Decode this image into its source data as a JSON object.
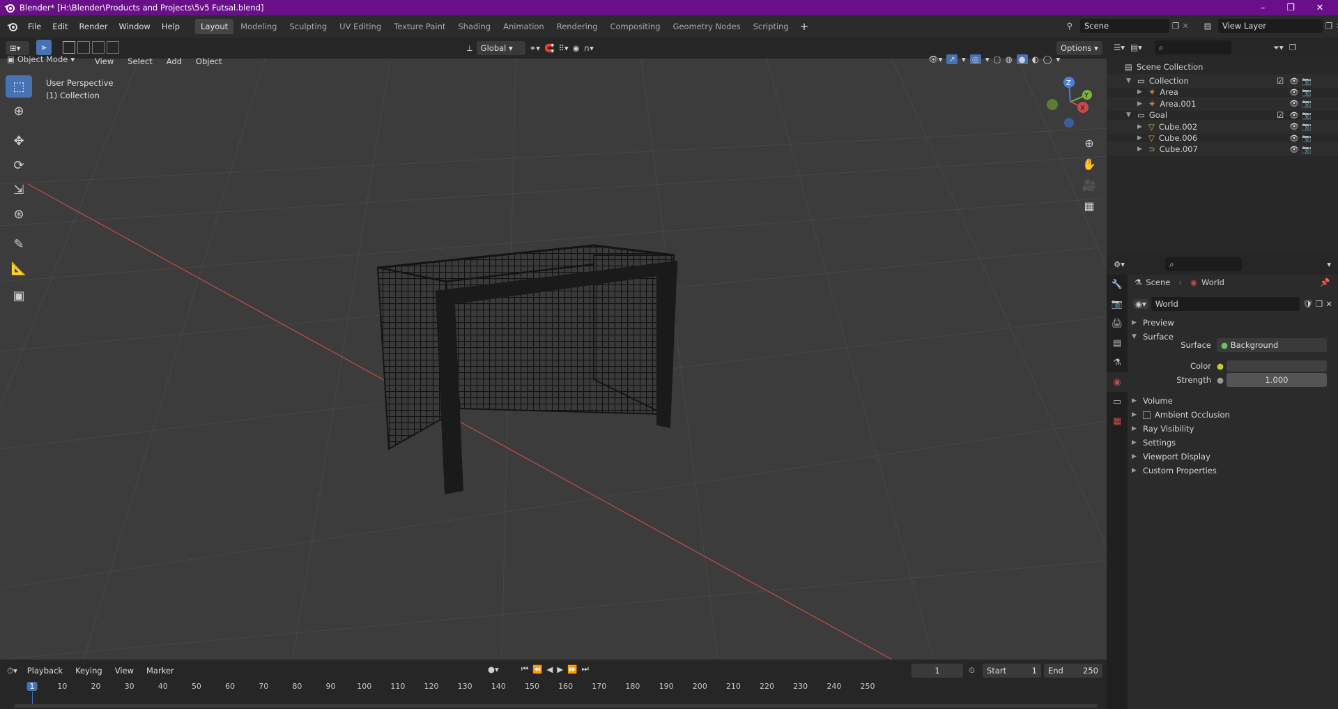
{
  "window": {
    "title": "Blender* [H:\\Blender\\Products and Projects\\5v5 Futsal.blend]",
    "minimize": "–",
    "maximize": "❐",
    "close": "✕"
  },
  "menu": [
    "File",
    "Edit",
    "Render",
    "Window",
    "Help"
  ],
  "workspaces": [
    {
      "label": "Layout",
      "active": true
    },
    {
      "label": "Modeling"
    },
    {
      "label": "Sculpting"
    },
    {
      "label": "UV Editing"
    },
    {
      "label": "Texture Paint"
    },
    {
      "label": "Shading"
    },
    {
      "label": "Animation"
    },
    {
      "label": "Rendering"
    },
    {
      "label": "Compositing"
    },
    {
      "label": "Geometry Nodes"
    },
    {
      "label": "Scripting"
    }
  ],
  "add_workspace": "+",
  "scene": {
    "name": "Scene"
  },
  "view_layer": {
    "name": "View Layer"
  },
  "viewport_header": {
    "transform_orientation": "Global",
    "options": "Options",
    "mode": "Object Mode",
    "menus": [
      "View",
      "Select",
      "Add",
      "Object"
    ]
  },
  "viewport": {
    "perspective": "User Perspective",
    "collection": "(1) Collection",
    "gizmo_axes": {
      "x": "X",
      "y": "Y",
      "z": "Z"
    }
  },
  "outliner": {
    "search_placeholder": "",
    "root": "Scene Collection",
    "items": [
      {
        "name": "Collection",
        "level": 0,
        "icon": "collection-icon",
        "expanded": true
      },
      {
        "name": "Area",
        "level": 1,
        "icon": "light-icon"
      },
      {
        "name": "Area.001",
        "level": 1,
        "icon": "light-icon"
      },
      {
        "name": "Goal",
        "level": 0,
        "icon": "collection-icon",
        "expanded": true
      },
      {
        "name": "Cube.002",
        "level": 1,
        "icon": "mesh-icon"
      },
      {
        "name": "Cube.006",
        "level": 1,
        "icon": "mesh-icon"
      },
      {
        "name": "Cube.007",
        "level": 1,
        "icon": "curve-icon"
      }
    ]
  },
  "properties": {
    "breadcrumb": {
      "scene": "Scene",
      "world": "World"
    },
    "world_name": "World",
    "panels": [
      {
        "label": "Preview",
        "open": false
      },
      {
        "label": "Surface",
        "open": true
      }
    ],
    "surface": {
      "surface_label": "Surface",
      "surface_value": "Background",
      "color_label": "Color",
      "strength_label": "Strength",
      "strength_value": "1.000"
    },
    "panels_after": [
      {
        "label": "Volume"
      },
      {
        "label": "Ambient Occlusion",
        "checkbox": true
      },
      {
        "label": "Ray Visibility"
      },
      {
        "label": "Settings"
      },
      {
        "label": "Viewport Display"
      },
      {
        "label": "Custom Properties"
      }
    ]
  },
  "timeline": {
    "menus": [
      "Playback",
      "Keying",
      "View",
      "Marker"
    ],
    "current_frame": "1",
    "start_label": "Start",
    "start": "1",
    "end_label": "End",
    "end": "250",
    "ruler": [
      "1",
      "10",
      "20",
      "30",
      "40",
      "50",
      "60",
      "70",
      "80",
      "90",
      "100",
      "110",
      "120",
      "130",
      "140",
      "150",
      "160",
      "170",
      "180",
      "190",
      "200",
      "210",
      "220",
      "230",
      "240",
      "250"
    ]
  },
  "colors": {
    "title_bar": "#6a0f8a",
    "accent": "#4772b3",
    "x_axis": "#c84a4a"
  }
}
